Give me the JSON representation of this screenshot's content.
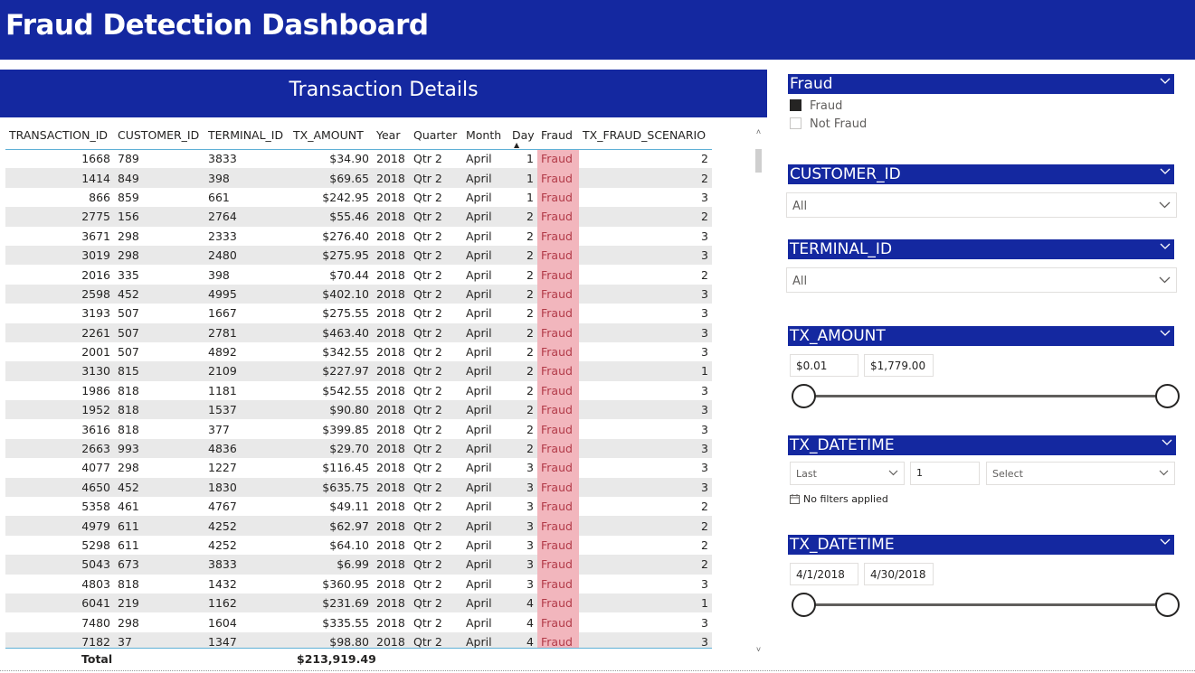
{
  "header": {
    "title": "Fraud Detection Dashboard"
  },
  "table": {
    "title": "Transaction Details",
    "columns": [
      "TRANSACTION_ID",
      "CUSTOMER_ID",
      "TERMINAL_ID",
      "TX_AMOUNT",
      "Year",
      "Quarter",
      "Month",
      "Day",
      "Fraud",
      "TX_FRAUD_SCENARIO"
    ],
    "sorted_column": "Day",
    "rows": [
      [
        "1668",
        "789",
        "3833",
        "$34.90",
        "2018",
        "Qtr 2",
        "April",
        "1",
        "Fraud",
        "2"
      ],
      [
        "1414",
        "849",
        "398",
        "$69.65",
        "2018",
        "Qtr 2",
        "April",
        "1",
        "Fraud",
        "2"
      ],
      [
        "866",
        "859",
        "661",
        "$242.95",
        "2018",
        "Qtr 2",
        "April",
        "1",
        "Fraud",
        "3"
      ],
      [
        "2775",
        "156",
        "2764",
        "$55.46",
        "2018",
        "Qtr 2",
        "April",
        "2",
        "Fraud",
        "2"
      ],
      [
        "3671",
        "298",
        "2333",
        "$276.40",
        "2018",
        "Qtr 2",
        "April",
        "2",
        "Fraud",
        "3"
      ],
      [
        "3019",
        "298",
        "2480",
        "$275.95",
        "2018",
        "Qtr 2",
        "April",
        "2",
        "Fraud",
        "3"
      ],
      [
        "2016",
        "335",
        "398",
        "$70.44",
        "2018",
        "Qtr 2",
        "April",
        "2",
        "Fraud",
        "2"
      ],
      [
        "2598",
        "452",
        "4995",
        "$402.10",
        "2018",
        "Qtr 2",
        "April",
        "2",
        "Fraud",
        "3"
      ],
      [
        "3193",
        "507",
        "1667",
        "$275.55",
        "2018",
        "Qtr 2",
        "April",
        "2",
        "Fraud",
        "3"
      ],
      [
        "2261",
        "507",
        "2781",
        "$463.40",
        "2018",
        "Qtr 2",
        "April",
        "2",
        "Fraud",
        "3"
      ],
      [
        "2001",
        "507",
        "4892",
        "$342.55",
        "2018",
        "Qtr 2",
        "April",
        "2",
        "Fraud",
        "3"
      ],
      [
        "3130",
        "815",
        "2109",
        "$227.97",
        "2018",
        "Qtr 2",
        "April",
        "2",
        "Fraud",
        "1"
      ],
      [
        "1986",
        "818",
        "1181",
        "$542.55",
        "2018",
        "Qtr 2",
        "April",
        "2",
        "Fraud",
        "3"
      ],
      [
        "1952",
        "818",
        "1537",
        "$90.80",
        "2018",
        "Qtr 2",
        "April",
        "2",
        "Fraud",
        "3"
      ],
      [
        "3616",
        "818",
        "377",
        "$399.85",
        "2018",
        "Qtr 2",
        "April",
        "2",
        "Fraud",
        "3"
      ],
      [
        "2663",
        "993",
        "4836",
        "$29.70",
        "2018",
        "Qtr 2",
        "April",
        "2",
        "Fraud",
        "3"
      ],
      [
        "4077",
        "298",
        "1227",
        "$116.45",
        "2018",
        "Qtr 2",
        "April",
        "3",
        "Fraud",
        "3"
      ],
      [
        "4650",
        "452",
        "1830",
        "$635.75",
        "2018",
        "Qtr 2",
        "April",
        "3",
        "Fraud",
        "3"
      ],
      [
        "5358",
        "461",
        "4767",
        "$49.11",
        "2018",
        "Qtr 2",
        "April",
        "3",
        "Fraud",
        "2"
      ],
      [
        "4979",
        "611",
        "4252",
        "$62.97",
        "2018",
        "Qtr 2",
        "April",
        "3",
        "Fraud",
        "2"
      ],
      [
        "5298",
        "611",
        "4252",
        "$64.10",
        "2018",
        "Qtr 2",
        "April",
        "3",
        "Fraud",
        "2"
      ],
      [
        "5043",
        "673",
        "3833",
        "$6.99",
        "2018",
        "Qtr 2",
        "April",
        "3",
        "Fraud",
        "2"
      ],
      [
        "4803",
        "818",
        "1432",
        "$360.95",
        "2018",
        "Qtr 2",
        "April",
        "3",
        "Fraud",
        "3"
      ],
      [
        "6041",
        "219",
        "1162",
        "$231.69",
        "2018",
        "Qtr 2",
        "April",
        "4",
        "Fraud",
        "1"
      ],
      [
        "7480",
        "298",
        "1604",
        "$335.55",
        "2018",
        "Qtr 2",
        "April",
        "4",
        "Fraud",
        "3"
      ],
      [
        "7182",
        "37",
        "1347",
        "$98.80",
        "2018",
        "Qtr 2",
        "April",
        "4",
        "Fraud",
        "3"
      ]
    ],
    "total_label": "Total",
    "total_amount": "$213,919.49"
  },
  "slicers": {
    "fraud": {
      "title": "Fraud",
      "options": [
        {
          "label": "Fraud",
          "checked": true
        },
        {
          "label": "Not Fraud",
          "checked": false
        }
      ]
    },
    "customer": {
      "title": "CUSTOMER_ID",
      "value": "All"
    },
    "terminal": {
      "title": "TERMINAL_ID",
      "value": "All"
    },
    "amount": {
      "title": "TX_AMOUNT",
      "min": "$0.01",
      "max": "$1,779.00"
    },
    "datetime_relative": {
      "title": "TX_DATETIME",
      "mode": "Last",
      "count": "1",
      "unit": "Select",
      "status": "No filters applied"
    },
    "datetime_range": {
      "title": "TX_DATETIME",
      "start": "4/1/2018",
      "end": "4/30/2018"
    }
  },
  "colors": {
    "brand": "#1428a0",
    "fraud_bg": "#f2b6bd",
    "fraud_text": "#b23a48",
    "row_alt": "#e9e9e9"
  },
  "icons": [
    "chevron-down-icon",
    "calendar-icon",
    "sort-ascending-icon"
  ]
}
